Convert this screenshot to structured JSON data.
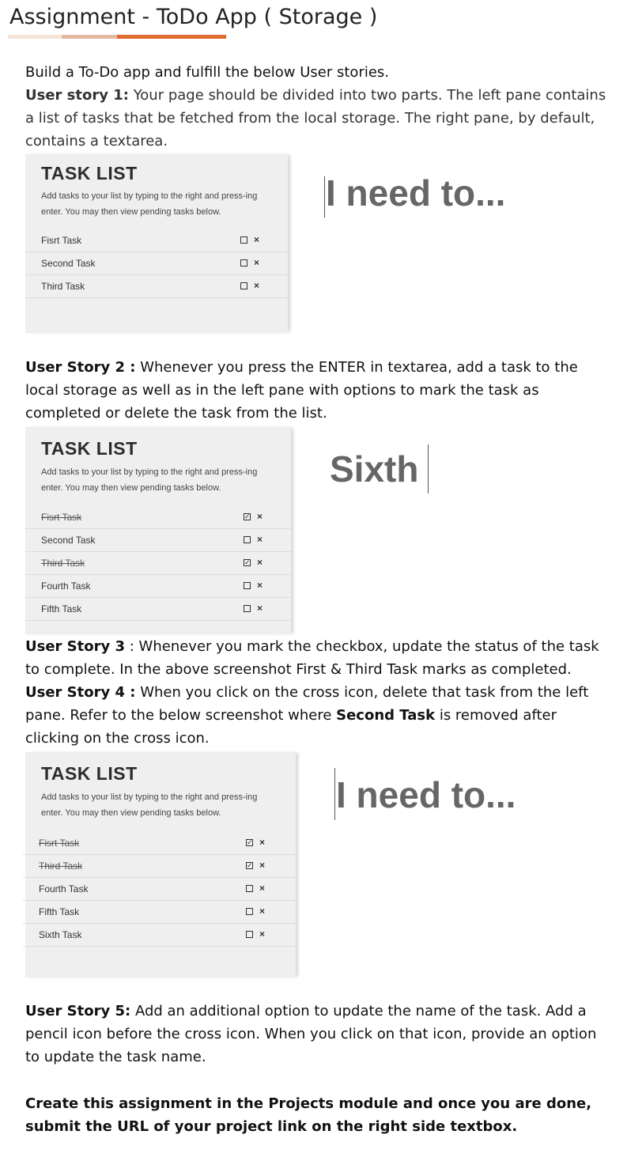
{
  "page": {
    "title": "Assignment - ToDo App ( Storage )",
    "intro": "Build a To-Do app and fulfill the below User stories.",
    "story1_label": "User story 1:",
    "story1_text": " Your page should be divided into two parts. The left pane contains a list of tasks that be fetched from the local storage. The right pane, by default, contains a textarea.",
    "story2_label": "User Story 2 :",
    "story2_text": " Whenever you press the ENTER in textarea, add a task to the local storage as well as in the left pane with options to mark the task as completed or delete the task from the list.",
    "story3_label": "User Story 3",
    "story3_text": " : Whenever you mark the checkbox, update the status of the task to complete. In the above screenshot First & Third Task marks as completed.",
    "story4_label": "User Story 4 :",
    "story4_text_a": " When you click on the cross icon, delete that task from the left pane. Refer to the below screenshot where ",
    "story4_bold": "Second Task",
    "story4_text_b": " is removed after clicking on the cross icon.",
    "story5_label": "User Story 5:",
    "story5_text": " Add an additional option to update the name of the task. Add a pencil icon before the cross icon. When you click on that icon, provide an option to update the task name.",
    "closing": "Create this assignment in the Projects module and once you are done, submit the URL of your project link on the right side textbox."
  },
  "colors": {
    "accent": "#e06a32",
    "accent_light": "#e3b9a3",
    "accent_pale": "#f6e3d8",
    "pane_bg": "#efefef",
    "editor_text": "#666666"
  },
  "screenshots": [
    {
      "pane_title": "TASK LIST",
      "pane_desc": "Add tasks to your list by typing to the right and press-ing enter. You may then view pending tasks below.",
      "tasks": [
        {
          "name": "Fisrt Task",
          "done": false
        },
        {
          "name": "Second Task",
          "done": false
        },
        {
          "name": "Third Task",
          "done": false
        }
      ],
      "editor_text": "I need to..."
    },
    {
      "pane_title": "TASK LIST",
      "pane_desc": "Add tasks to your list by typing to the right and press-ing enter. You may then view pending tasks below.",
      "tasks": [
        {
          "name": "Fisrt Task",
          "done": true
        },
        {
          "name": "Second Task",
          "done": false
        },
        {
          "name": "Third Task",
          "done": true
        },
        {
          "name": "Fourth Task",
          "done": false
        },
        {
          "name": "Fifth Task",
          "done": false
        }
      ],
      "editor_text": "Sixth"
    },
    {
      "pane_title": "TASK LIST",
      "pane_desc": "Add tasks to your list by typing to the right and press-ing enter. You may then view pending tasks below.",
      "tasks": [
        {
          "name": "Fisrt Task",
          "done": true
        },
        {
          "name": "Third Task",
          "done": true
        },
        {
          "name": "Fourth Task",
          "done": false
        },
        {
          "name": "Fifth Task",
          "done": false
        },
        {
          "name": "Sixth Task",
          "done": false
        }
      ],
      "editor_text": "I need to..."
    }
  ],
  "icons": {
    "checkbox_checked": "check-box-icon",
    "checkbox_unchecked": "empty-box-icon",
    "delete": "cross-icon"
  }
}
